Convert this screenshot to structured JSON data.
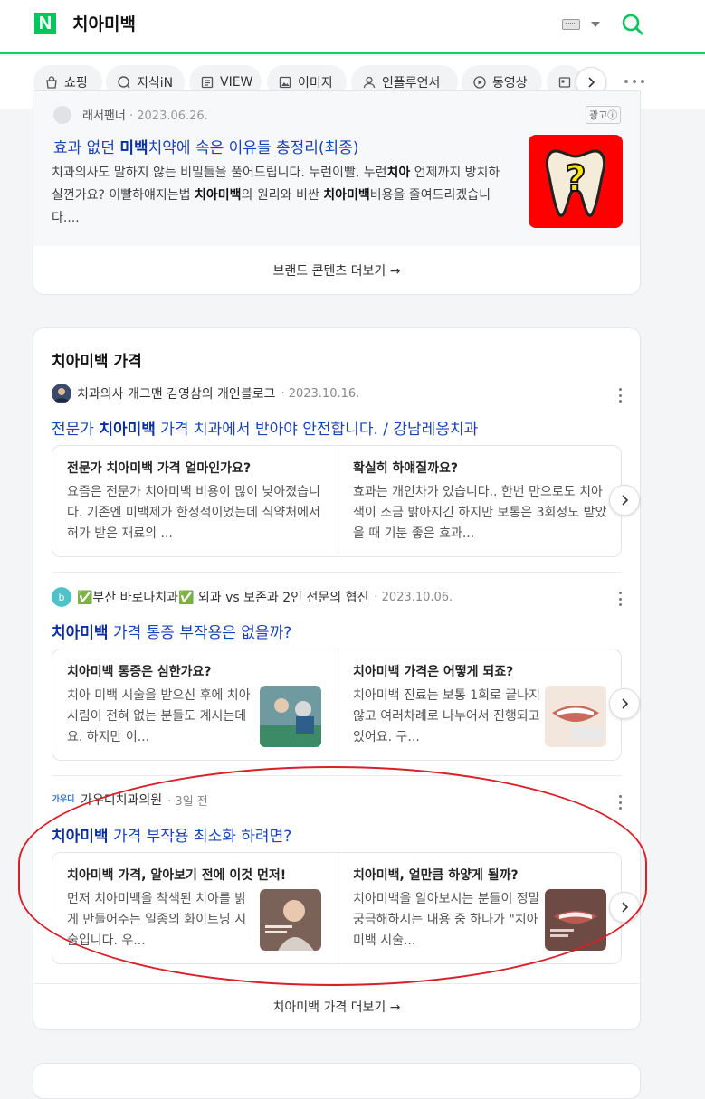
{
  "header": {
    "logo": "N",
    "query": "치아미백"
  },
  "tabs": [
    {
      "label": "쇼핑",
      "icon": "shopping-bag-icon"
    },
    {
      "label": "지식iN",
      "icon": "qna-icon"
    },
    {
      "label": "VIEW",
      "icon": "view-icon"
    },
    {
      "label": "이미지",
      "icon": "image-icon"
    },
    {
      "label": "인플루언서",
      "icon": "person-icon"
    },
    {
      "label": "동영상",
      "icon": "play-icon"
    }
  ],
  "ad": {
    "source": "래서팬너",
    "date": "2023.06.26.",
    "badge": "광고ⓘ",
    "title_pre": "효과 없던 ",
    "title_bold": "미백",
    "title_post": "치약에 속은 이유들 총정리(최종)",
    "desc_1": "치과의사도 말하지 않는 비밀들을 풀어드립니다. 누런이빨, 누런",
    "desc_b1": "치아",
    "desc_2": " 언제까지 방치하실껀가요? 이빨하얘지는법 ",
    "desc_b2": "치아미백",
    "desc_3": "의 원리와 비싼 ",
    "desc_b3": "치아미백",
    "desc_4": "비용을 줄여드리겠습니다....",
    "thumb_mark": "?",
    "more": "브랜드 콘텐츠 더보기 →"
  },
  "section": {
    "title": "치아미백 가격",
    "posts": [
      {
        "author": "치과의사 개그맨 김영삼의 개인블로그",
        "date": "· 2023.10.16.",
        "title_pre": "전문가 ",
        "title_bold": "치아미백",
        "title_post": " 가격 치과에서 받아야 안전합니다. / 강남레옹치과",
        "left_q": "전문가 치아미백 가격 얼마인가요?",
        "left_a": "요즘은 전문가 치아미백 비용이 많이 낮아졌습니다. 기존엔 미백제가 한정적이었는데 식약처에서 허가 받은 재료의 ...",
        "right_q": "확실히 하얘질까요?",
        "right_a": "효과는 개인차가 있습니다.. 한번 만으로도 치아색이 조금 밝아지긴 하지만 보통은 3회정도 받았을 때 기분 좋은 효과..."
      },
      {
        "author": "✅부산 바로나치과✅ 외과 vs 보존과 2인 전문의 협진",
        "date": "· 2023.10.06.",
        "title_pre": "",
        "title_bold": "치아미백",
        "title_post": " 가격 통증 부작용은 없을까?",
        "left_q": "치아미백 통증은 심한가요?",
        "left_a": "치아 미백 시술을 받으신 후에 치아 시림이 전혀 없는 분들도 계시는데요. 하지만 이...",
        "right_q": "치아미백 가격은 어떻게 되죠?",
        "right_a": "치아미백 진료는 보통 1회로 끝나지 않고 여러차례로 나누어서 진행되고 있어요. 구..."
      },
      {
        "author": "가우디치과의원",
        "date": "· 3일 전",
        "avatar_text": "가우디",
        "title_pre": "",
        "title_bold": "치아미백",
        "title_post": " 가격 부작용 최소화 하려면?",
        "left_q": "치아미백 가격, 알아보기 전에 이것 먼저!",
        "left_a": "먼저 치아미백을 착색된 치아를 밝게 만들어주는 일종의 화이트닝 시술입니다. 우...",
        "right_q": "치아미백, 얼만큼 하얗게 될까?",
        "right_a": "치아미백을 알아보시는 분들이 정말 궁금해하시는 내용 중 하나가 \"치아미백 시술..."
      }
    ],
    "more": "치아미백 가격 더보기 →"
  },
  "colors": {
    "brand": "#03c75a",
    "link": "#1a43b8",
    "highlight": "#d9202a"
  }
}
